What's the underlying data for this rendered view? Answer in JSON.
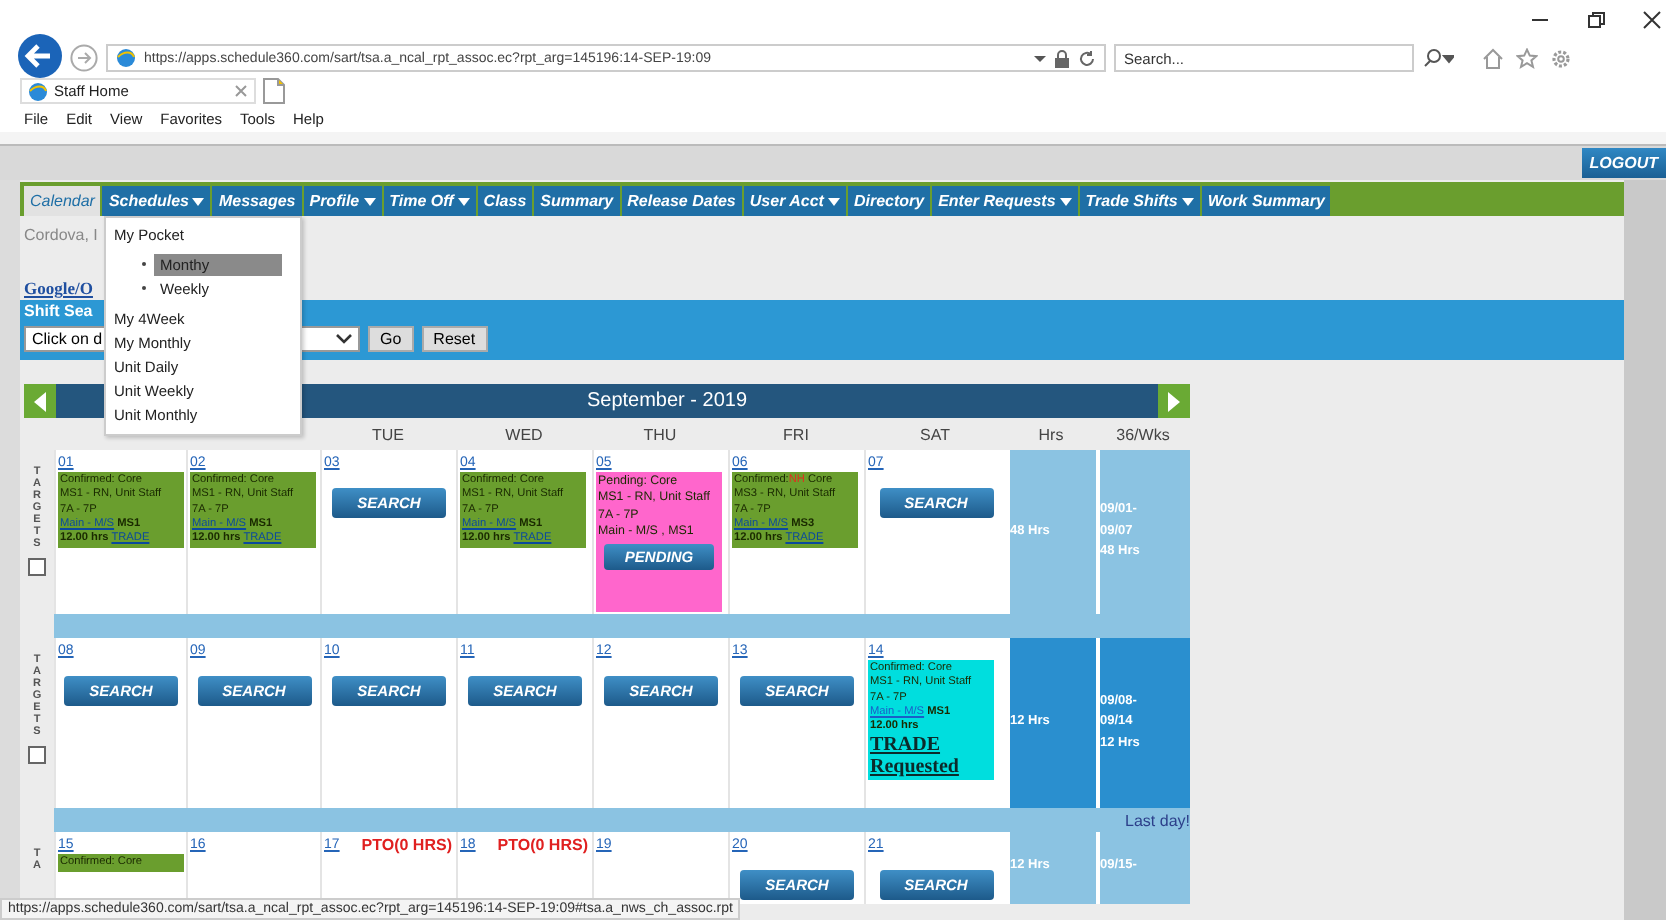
{
  "browser": {
    "url": "https://apps.schedule360.com/sart/tsa.a_ncal_rpt_assoc.ec?rpt_arg=145196:14-SEP-19:09",
    "search_placeholder": "Search...",
    "tabs": [
      {
        "title": "Staff Home",
        "selected": true
      }
    ],
    "menu": [
      "File",
      "Edit",
      "View",
      "Favorites",
      "Tools",
      "Help"
    ],
    "status_url": "https://apps.schedule360.com/sart/tsa.a_ncal_rpt_assoc.ec?rpt_arg=145196:14-SEP-19:09#tsa.a_nws_ch_assoc.rpt"
  },
  "logout": "LOGOUT",
  "nav": [
    {
      "label": "Calendar",
      "selected": true,
      "has_menu": false
    },
    {
      "label": "Schedules",
      "selected": false,
      "has_menu": true
    },
    {
      "label": "Messages",
      "selected": false,
      "has_menu": false
    },
    {
      "label": "Profile",
      "selected": false,
      "has_menu": true
    },
    {
      "label": "Time Off",
      "selected": false,
      "has_menu": true
    },
    {
      "label": "Class",
      "selected": false,
      "has_menu": false
    },
    {
      "label": "Summary",
      "selected": false,
      "has_menu": false
    },
    {
      "label": "Release Dates",
      "selected": false,
      "has_menu": false
    },
    {
      "label": "User Acct",
      "selected": false,
      "has_menu": true
    },
    {
      "label": "Directory",
      "selected": false,
      "has_menu": false
    },
    {
      "label": "Enter Requests",
      "selected": false,
      "has_menu": true
    },
    {
      "label": "Trade Shifts",
      "selected": false,
      "has_menu": true
    },
    {
      "label": "Work Summary",
      "selected": false,
      "has_menu": false
    }
  ],
  "dropdown": {
    "items": [
      {
        "label": "My Pocket",
        "children": [
          {
            "label": "Monthy",
            "selected": true
          },
          {
            "label": "Weekly",
            "selected": false
          }
        ]
      },
      {
        "label": "My 4Week"
      },
      {
        "label": "My Monthly"
      },
      {
        "label": "Unit Daily"
      },
      {
        "label": "Unit Weekly"
      },
      {
        "label": "Unit Monthly"
      }
    ]
  },
  "user_name": "Cordova, I",
  "google_link": "Google/O",
  "shift_search": {
    "title": "Shift Sea",
    "select_value": "Click on d",
    "go": "Go",
    "reset": "Reset"
  },
  "calendar": {
    "title": "September - 2019",
    "headers": [
      "TUE",
      "WED",
      "THU",
      "FRI",
      "SAT",
      "Hrs",
      "36/Wks"
    ],
    "weeks": [
      {
        "targets": "TARGETS",
        "checked": false,
        "current": false,
        "hrs": "48 Hrs",
        "period": [
          "09/01-",
          "09/07",
          "48 Hrs"
        ],
        "days": [
          {
            "date": "01",
            "kind": "shift",
            "status": "Confirmed: Core",
            "role": "MS1 - RN, Unit Staff",
            "time": "7A - 7P",
            "location": "Main - M/S",
            "unit": "MS1",
            "hours": "12.00 hrs",
            "trade": "TRADE"
          },
          {
            "date": "02",
            "kind": "shift",
            "status": "Confirmed: Core",
            "role": "MS1 - RN, Unit Staff",
            "time": "7A - 7P",
            "location": "Main - M/S",
            "unit": "MS1",
            "hours": "12.00 hrs",
            "trade": "TRADE"
          },
          {
            "date": "03",
            "kind": "search",
            "button": "SEARCH"
          },
          {
            "date": "04",
            "kind": "shift",
            "status": "Confirmed: Core",
            "role": "MS1 - RN, Unit Staff",
            "time": "7A - 7P",
            "location": "Main - M/S",
            "unit": "MS1",
            "hours": "12.00 hrs",
            "trade": "TRADE"
          },
          {
            "date": "05",
            "kind": "pending",
            "status": "Pending: Core",
            "role": "MS1 - RN, Unit Staff",
            "time": "7A - 7P",
            "location": "Main - M/S , MS1",
            "button": "PENDING"
          },
          {
            "date": "06",
            "kind": "shift",
            "status": "Confirmed:",
            "flag": "NH",
            "status_tail": "Core",
            "role": "MS3 - RN, Unit Staff",
            "time": "7A - 7P",
            "location": "Main - M/S",
            "unit": "MS3",
            "hours": "12.00 hrs",
            "trade": "TRADE"
          },
          {
            "date": "07",
            "kind": "search",
            "button": "SEARCH"
          }
        ]
      },
      {
        "targets": "TARGETS",
        "checked": false,
        "current": true,
        "hrs": "12 Hrs",
        "period": [
          "09/08-",
          "09/14",
          "12 Hrs"
        ],
        "days": [
          {
            "date": "08",
            "kind": "search",
            "button": "SEARCH"
          },
          {
            "date": "09",
            "kind": "search",
            "button": "SEARCH"
          },
          {
            "date": "10",
            "kind": "search",
            "button": "SEARCH"
          },
          {
            "date": "11",
            "kind": "search",
            "button": "SEARCH"
          },
          {
            "date": "12",
            "kind": "search",
            "button": "SEARCH"
          },
          {
            "date": "13",
            "kind": "search",
            "button": "SEARCH"
          },
          {
            "date": "14",
            "kind": "trade",
            "status": "Confirmed: Core",
            "role": "MS1 - RN, Unit Staff",
            "time": "7A - 7P",
            "location": "Main - M/S",
            "unit": "MS1",
            "hours": "12.00 hrs",
            "trade": "TRADE Requested"
          }
        ]
      },
      {
        "note": "Last day!",
        "targets": "TA",
        "current": false,
        "hrs": "12 Hrs",
        "period": [
          "09/15-"
        ],
        "days": [
          {
            "date": "15",
            "kind": "partial",
            "status": "Confirmed: Core"
          },
          {
            "date": "16",
            "kind": "empty"
          },
          {
            "date": "17",
            "kind": "empty",
            "pto": "PTO(0 HRS)"
          },
          {
            "date": "18",
            "kind": "empty",
            "pto": "PTO(0 HRS)"
          },
          {
            "date": "19",
            "kind": "empty"
          },
          {
            "date": "20",
            "kind": "search",
            "button": "SEARCH"
          },
          {
            "date": "21",
            "kind": "search",
            "button": "SEARCH"
          }
        ]
      }
    ]
  }
}
